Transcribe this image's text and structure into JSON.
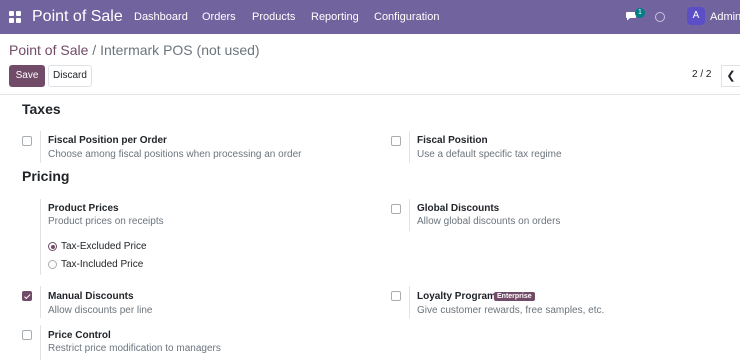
{
  "topbar": {
    "app_name": "Point of Sale",
    "menu": [
      "Dashboard",
      "Orders",
      "Products",
      "Reporting",
      "Configuration"
    ],
    "chat_count": "1",
    "avatar_letter": "A",
    "user_name": "Adminis",
    "colors": {
      "bar": "#71639e",
      "badge": "#017e84"
    }
  },
  "breadcrumb": {
    "root": "Point of Sale",
    "separator": " / ",
    "current": "Intermark POS (not used)"
  },
  "actions": {
    "save": "Save",
    "discard": "Discard"
  },
  "pager": {
    "value": "2 / 2",
    "prev_icon": "chevron-left-icon"
  },
  "sections": {
    "taxes": {
      "title": "Taxes",
      "fiscal_position_per_order": {
        "title": "Fiscal Position per Order",
        "desc": "Choose among fiscal positions when processing an order",
        "checked": false
      },
      "fiscal_position": {
        "title": "Fiscal Position",
        "desc": "Use a default specific tax regime",
        "checked": false
      }
    },
    "pricing": {
      "title": "Pricing",
      "product_prices": {
        "title": "Product Prices",
        "desc": "Product prices on receipts",
        "options": [
          "Tax-Excluded Price",
          "Tax-Included Price"
        ],
        "selected": "Tax-Excluded Price"
      },
      "global_discounts": {
        "title": "Global Discounts",
        "desc": "Allow global discounts on orders",
        "checked": false
      },
      "manual_discounts": {
        "title": "Manual Discounts",
        "desc": "Allow discounts per line",
        "checked": true
      },
      "loyalty_program": {
        "title": "Loyalty Program",
        "badge": "Enterprise",
        "desc": "Give customer rewards, free samples, etc.",
        "checked": false
      },
      "price_control": {
        "title": "Price Control",
        "desc": "Restrict price modification to managers",
        "checked": false
      }
    }
  },
  "accent": "#714b67"
}
